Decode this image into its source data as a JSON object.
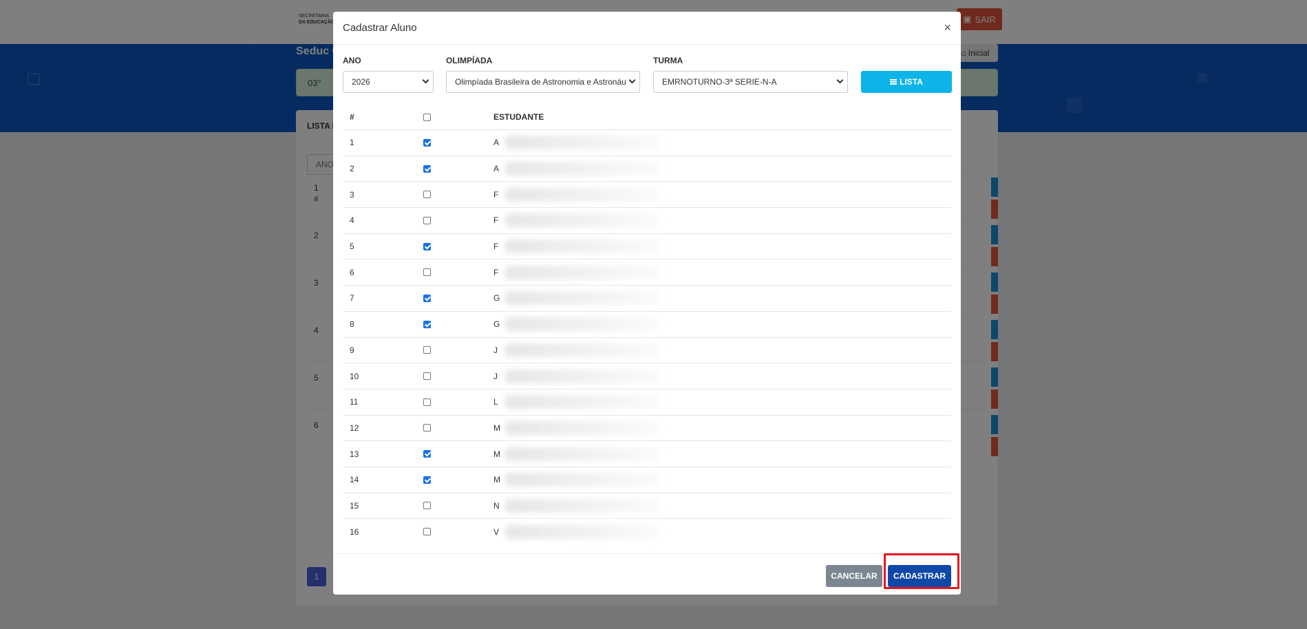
{
  "background": {
    "logo_line1": "SECRETARIA",
    "logo_line2": "DA EDUCAÇÃO",
    "sair_label": "SAIR",
    "banner_title": "Seduc C",
    "inicial_label": "Inicial",
    "alert_text": "03°",
    "card_title": "LISTA D",
    "filter_text": "ANO",
    "hash": "#",
    "rows": [
      "1",
      "2",
      "3",
      "4",
      "5",
      "6"
    ],
    "page": "1"
  },
  "modal": {
    "title": "Cadastrar Aluno",
    "close": "×",
    "fields": {
      "ano": {
        "label": "ANO",
        "value": "2026"
      },
      "olimpiada": {
        "label": "OLIMPÍADA",
        "value": "Olimpíada Brasileira de Astronomia e Astronáu"
      },
      "turma": {
        "label": "TURMA",
        "value": "EMRNOTURNO-3ª SERIE-N-A"
      }
    },
    "lista_label": "LISTA",
    "table": {
      "col_num": "#",
      "col_student": "ESTUDANTE",
      "rows": [
        {
          "num": "1",
          "checked": true,
          "initial": "A"
        },
        {
          "num": "2",
          "checked": true,
          "initial": "A"
        },
        {
          "num": "3",
          "checked": false,
          "initial": "F"
        },
        {
          "num": "4",
          "checked": false,
          "initial": "F"
        },
        {
          "num": "5",
          "checked": true,
          "initial": "F"
        },
        {
          "num": "6",
          "checked": false,
          "initial": "F"
        },
        {
          "num": "7",
          "checked": true,
          "initial": "G"
        },
        {
          "num": "8",
          "checked": true,
          "initial": "G"
        },
        {
          "num": "9",
          "checked": false,
          "initial": "J"
        },
        {
          "num": "10",
          "checked": false,
          "initial": "J"
        },
        {
          "num": "11",
          "checked": false,
          "initial": "L"
        },
        {
          "num": "12",
          "checked": false,
          "initial": "M"
        },
        {
          "num": "13",
          "checked": true,
          "initial": "M"
        },
        {
          "num": "14",
          "checked": true,
          "initial": "M"
        },
        {
          "num": "15",
          "checked": false,
          "initial": "N"
        },
        {
          "num": "16",
          "checked": false,
          "initial": "V"
        }
      ]
    },
    "cancel_label": "CANCELAR",
    "submit_label": "CADASTRAR"
  },
  "colors": {
    "banner": "#0d56c2",
    "lista_button": "#0db4ea",
    "submit_button": "#1048a8",
    "cancel_button": "#7a8793",
    "highlight": "#e8141b",
    "checkbox_checked": "#1a73e8"
  }
}
